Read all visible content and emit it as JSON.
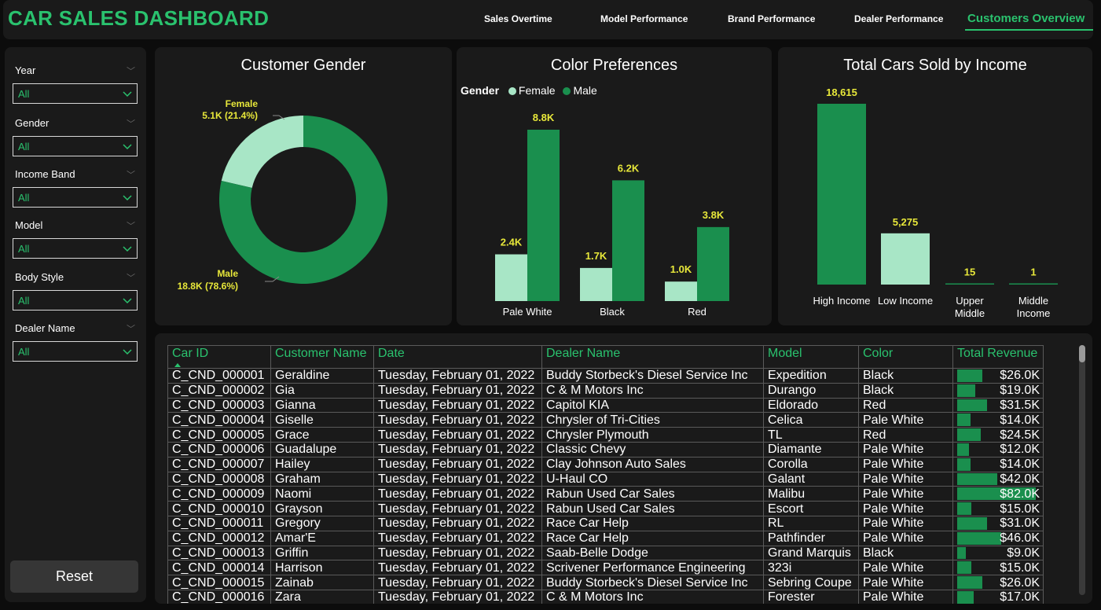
{
  "app": {
    "title": "CAR SALES DASHBOARD"
  },
  "nav": {
    "tabs": [
      {
        "label": "Sales Overtime"
      },
      {
        "label": "Model Performance"
      },
      {
        "label": "Brand Performance"
      },
      {
        "label": "Dealer Performance"
      },
      {
        "label": "Customers Overview"
      }
    ],
    "active": "Customers Overview"
  },
  "filters": [
    {
      "label": "Year",
      "value": "All"
    },
    {
      "label": "Gender",
      "value": "All"
    },
    {
      "label": "Income Band",
      "value": "All"
    },
    {
      "label": "Model",
      "value": "All"
    },
    {
      "label": "Body Style",
      "value": "All"
    },
    {
      "label": "Dealer Name",
      "value": "All"
    }
  ],
  "reset_label": "Reset",
  "colors": {
    "accent": "#2ac26e",
    "male": "#1a8f4e",
    "female": "#a8e6c6",
    "value_label": "#e8e83a"
  },
  "chart_data": [
    {
      "type": "pie",
      "title": "Customer Gender",
      "slices": [
        {
          "label": "Female",
          "value": 5100,
          "display": "5.1K (21.4%)",
          "percent": 21.4
        },
        {
          "label": "Male",
          "value": 18800,
          "display": "18.8K (78.6%)",
          "percent": 78.6
        }
      ]
    },
    {
      "type": "bar",
      "title": "Color Preferences",
      "legend_title": "Gender",
      "categories": [
        "Pale White",
        "Black",
        "Red"
      ],
      "series": [
        {
          "name": "Female",
          "values": [
            2400,
            1700,
            1000
          ],
          "labels": [
            "2.4K",
            "1.7K",
            "1.0K"
          ]
        },
        {
          "name": "Male",
          "values": [
            8800,
            6200,
            3800
          ],
          "labels": [
            "8.8K",
            "6.2K",
            "3.8K"
          ]
        }
      ],
      "ylim": [
        0,
        8800
      ]
    },
    {
      "type": "bar",
      "title": "Total Cars Sold by Income",
      "categories": [
        "High Income",
        "Low Income",
        "Upper Middle",
        "Middle Income"
      ],
      "values": [
        18615,
        5275,
        15,
        1
      ],
      "labels": [
        "18,615",
        "5,275",
        "15",
        "1"
      ],
      "ylim": [
        0,
        18615
      ]
    }
  ],
  "table": {
    "columns": [
      "Car ID",
      "Customer Name",
      "Date",
      "Dealer Name",
      "Model",
      "Color",
      "Total Revenue"
    ],
    "rev_max": 82000,
    "rows": [
      {
        "id": "C_CND_000001",
        "name": "Geraldine",
        "date": "Tuesday, February 01, 2022",
        "dealer": "Buddy Storbeck's Diesel Service Inc",
        "model": "Expedition",
        "color": "Black",
        "revenue": "$26.0K",
        "rev": 26000
      },
      {
        "id": "C_CND_000002",
        "name": "Gia",
        "date": "Tuesday, February 01, 2022",
        "dealer": "C & M Motors Inc",
        "model": "Durango",
        "color": "Black",
        "revenue": "$19.0K",
        "rev": 19000
      },
      {
        "id": "C_CND_000003",
        "name": "Gianna",
        "date": "Tuesday, February 01, 2022",
        "dealer": "Capitol KIA",
        "model": "Eldorado",
        "color": "Red",
        "revenue": "$31.5K",
        "rev": 31500
      },
      {
        "id": "C_CND_000004",
        "name": "Giselle",
        "date": "Tuesday, February 01, 2022",
        "dealer": "Chrysler of Tri-Cities",
        "model": "Celica",
        "color": "Pale White",
        "revenue": "$14.0K",
        "rev": 14000
      },
      {
        "id": "C_CND_000005",
        "name": "Grace",
        "date": "Tuesday, February 01, 2022",
        "dealer": "Chrysler Plymouth",
        "model": "TL",
        "color": "Red",
        "revenue": "$24.5K",
        "rev": 24500
      },
      {
        "id": "C_CND_000006",
        "name": "Guadalupe",
        "date": "Tuesday, February 01, 2022",
        "dealer": "Classic Chevy",
        "model": "Diamante",
        "color": "Pale White",
        "revenue": "$12.0K",
        "rev": 12000
      },
      {
        "id": "C_CND_000007",
        "name": "Hailey",
        "date": "Tuesday, February 01, 2022",
        "dealer": "Clay Johnson Auto Sales",
        "model": "Corolla",
        "color": "Pale White",
        "revenue": "$14.0K",
        "rev": 14000
      },
      {
        "id": "C_CND_000008",
        "name": "Graham",
        "date": "Tuesday, February 01, 2022",
        "dealer": "U-Haul CO",
        "model": "Galant",
        "color": "Pale White",
        "revenue": "$42.0K",
        "rev": 42000
      },
      {
        "id": "C_CND_000009",
        "name": "Naomi",
        "date": "Tuesday, February 01, 2022",
        "dealer": "Rabun Used Car Sales",
        "model": "Malibu",
        "color": "Pale White",
        "revenue": "$82.0K",
        "rev": 82000
      },
      {
        "id": "C_CND_000010",
        "name": "Grayson",
        "date": "Tuesday, February 01, 2022",
        "dealer": "Rabun Used Car Sales",
        "model": "Escort",
        "color": "Pale White",
        "revenue": "$15.0K",
        "rev": 15000
      },
      {
        "id": "C_CND_000011",
        "name": "Gregory",
        "date": "Tuesday, February 01, 2022",
        "dealer": "Race Car Help",
        "model": "RL",
        "color": "Pale White",
        "revenue": "$31.0K",
        "rev": 31000
      },
      {
        "id": "C_CND_000012",
        "name": "Amar'E",
        "date": "Tuesday, February 01, 2022",
        "dealer": "Race Car Help",
        "model": "Pathfinder",
        "color": "Pale White",
        "revenue": "$46.0K",
        "rev": 46000
      },
      {
        "id": "C_CND_000013",
        "name": "Griffin",
        "date": "Tuesday, February 01, 2022",
        "dealer": "Saab-Belle Dodge",
        "model": "Grand Marquis",
        "color": "Black",
        "revenue": "$9.0K",
        "rev": 9000
      },
      {
        "id": "C_CND_000014",
        "name": "Harrison",
        "date": "Tuesday, February 01, 2022",
        "dealer": "Scrivener Performance Engineering",
        "model": "323i",
        "color": "Pale White",
        "revenue": "$15.0K",
        "rev": 15000
      },
      {
        "id": "C_CND_000015",
        "name": "Zainab",
        "date": "Tuesday, February 01, 2022",
        "dealer": "Buddy Storbeck's Diesel Service Inc",
        "model": "Sebring Coupe",
        "color": "Pale White",
        "revenue": "$26.0K",
        "rev": 26000
      },
      {
        "id": "C_CND_000016",
        "name": "Zara",
        "date": "Tuesday, February 01, 2022",
        "dealer": "C & M Motors Inc",
        "model": "Forester",
        "color": "Pale White",
        "revenue": "$17.0K",
        "rev": 17000
      }
    ]
  }
}
